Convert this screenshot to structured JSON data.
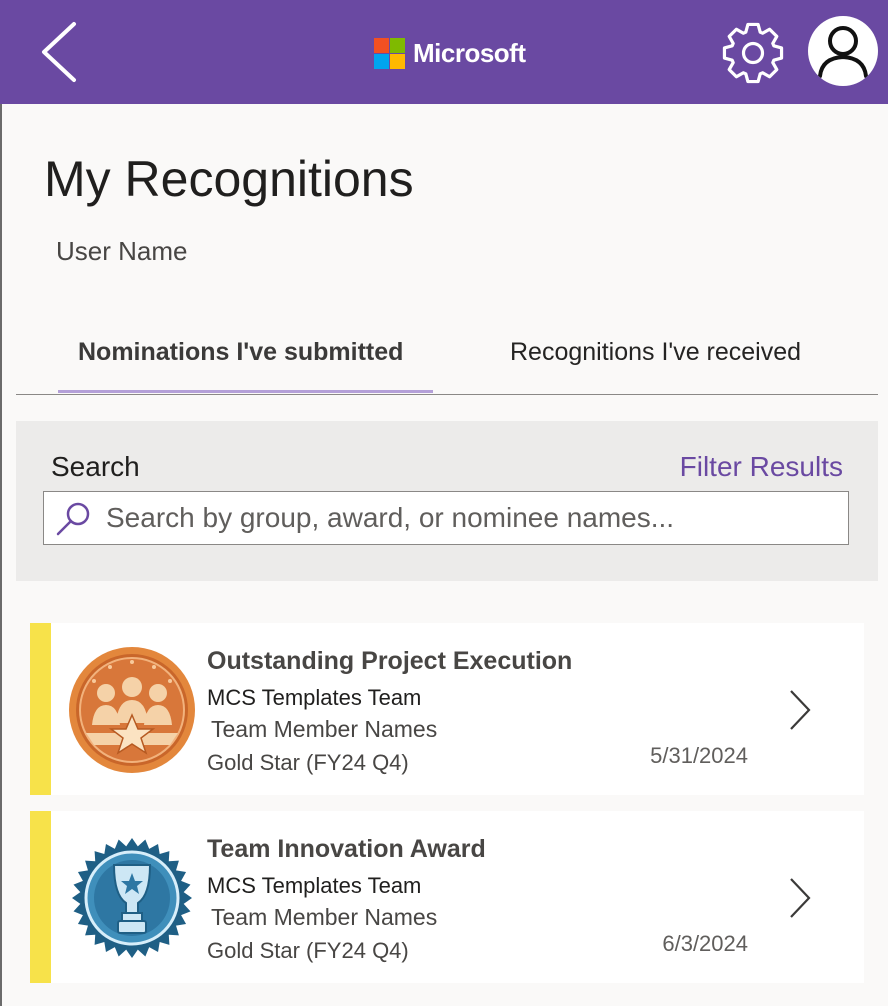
{
  "header": {
    "brand": "Microsoft",
    "brand_colors": [
      "#f25022",
      "#7fba00",
      "#00a4ef",
      "#ffb900"
    ],
    "back_icon": "chevron-left-icon",
    "settings_icon": "gear-icon",
    "avatar_icon": "person-icon",
    "background_color": "#6a49a2"
  },
  "page": {
    "title": "My Recognitions",
    "user_name": "User Name"
  },
  "tabs": [
    {
      "label": "Nominations I've submitted",
      "selected": true
    },
    {
      "label": "Recognitions I've received",
      "selected": false
    }
  ],
  "search": {
    "label": "Search",
    "filter_label": "Filter Results",
    "placeholder": "Search by group, award, or nominee names...",
    "value": ""
  },
  "nominations": [
    {
      "title": "Outstanding Project Execution",
      "group": "MCS Templates Team",
      "members": "Team Member Names",
      "period": "Gold Star (FY24 Q4)",
      "date": "5/31/2024",
      "badge_icon": "team-medal-icon",
      "accent_color": "#f7e24a"
    },
    {
      "title": "Team Innovation Award",
      "group": "MCS Templates Team",
      "members": "Team Member Names",
      "period": "Gold Star (FY24 Q4)",
      "date": "6/3/2024",
      "badge_icon": "trophy-seal-icon",
      "accent_color": "#f7e24a"
    }
  ]
}
